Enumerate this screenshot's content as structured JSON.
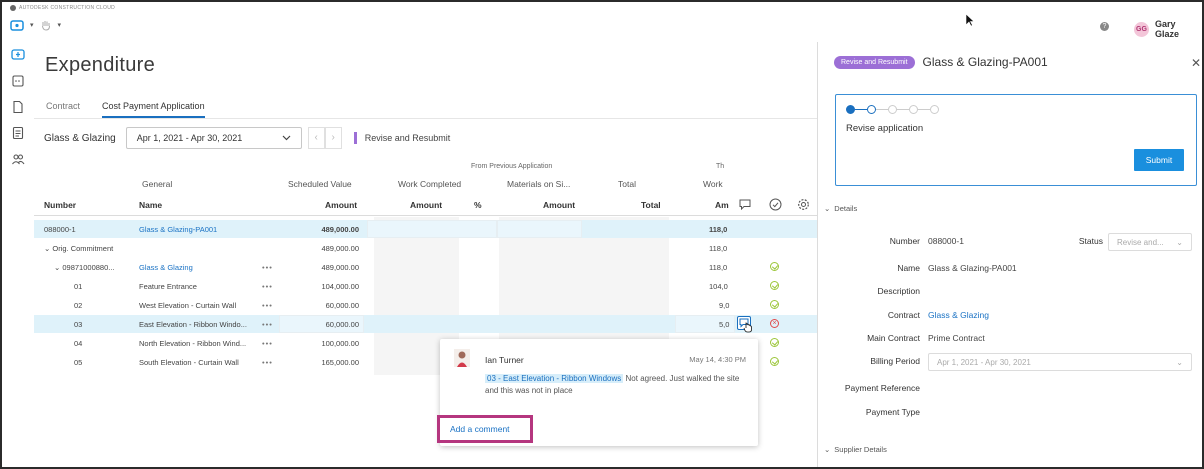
{
  "app": {
    "brand": "AUTODESK CONSTRUCTION CLOUD",
    "user_initials": "GG",
    "user_name": "Gary Glaze",
    "help_label": "?"
  },
  "page": {
    "title": "Expenditure",
    "tabs": [
      {
        "label": "Contract",
        "active": false
      },
      {
        "label": "Cost Payment Application",
        "active": true
      }
    ],
    "contract_name": "Glass & Glazing",
    "date_range": "Apr 1, 2021 - Apr 30, 2021",
    "status": "Revise and Resubmit",
    "status_color": "#9c6fd6"
  },
  "table": {
    "small_headers": [
      "From Previous Application",
      "Th"
    ],
    "group_headers": [
      "General",
      "Scheduled Value",
      "Work Completed",
      "Materials on Si...",
      "Total",
      "Work"
    ],
    "column_headers": [
      "Number",
      "Name",
      "Amount",
      "Amount",
      "%",
      "Amount",
      "Total",
      "Am"
    ],
    "rows": [
      {
        "number": "088000-1",
        "name": "Glass & Glazing-PA001",
        "name_link": true,
        "scheduled": "489,000.00",
        "this_work": "118,0",
        "selected": true,
        "bold": true,
        "menu": "",
        "status": ""
      },
      {
        "number": "⌄ Orig. Commitment",
        "name": "",
        "name_link": false,
        "scheduled": "489,000.00",
        "this_work": "118,0",
        "selected": false,
        "bold": false,
        "menu": "",
        "status": ""
      },
      {
        "number": "⌄ 09871000880...",
        "name": "Glass & Glazing",
        "name_link": true,
        "scheduled": "489,000.00",
        "this_work": "118,0",
        "selected": false,
        "bold": false,
        "menu": "•••",
        "status": "pending"
      },
      {
        "number": "01",
        "name": "Feature Entrance",
        "name_link": false,
        "scheduled": "104,000.00",
        "this_work": "104,0",
        "selected": false,
        "bold": false,
        "menu": "•••",
        "status": "ok"
      },
      {
        "number": "02",
        "name": "West Elevation - Curtain Wall",
        "name_link": false,
        "scheduled": "60,000.00",
        "this_work": "9,0",
        "selected": false,
        "bold": false,
        "menu": "•••",
        "status": "ok"
      },
      {
        "number": "03",
        "name": "East Elevation - Ribbon Windo...",
        "name_link": false,
        "scheduled": "60,000.00",
        "this_work": "5,0",
        "selected": true,
        "bold": false,
        "menu": "•••",
        "status": "rejected"
      },
      {
        "number": "04",
        "name": "North Elevation - Ribbon Wind...",
        "name_link": false,
        "scheduled": "100,000.00",
        "this_work": "",
        "selected": false,
        "bold": false,
        "menu": "•••",
        "status": "ok"
      },
      {
        "number": "05",
        "name": "South Elevation - Curtain Wall",
        "name_link": false,
        "scheduled": "165,000.00",
        "this_work": "",
        "selected": false,
        "bold": false,
        "menu": "•••",
        "status": "ok"
      }
    ]
  },
  "comment": {
    "author": "Ian Turner",
    "time": "May 14, 4:30 PM",
    "tag": "03 - East Elevation - Ribbon Windows",
    "text": "Not agreed. Just walked the site and this was not in place",
    "add_label": "Add a comment"
  },
  "panel": {
    "badge": "Revise and Resubmit",
    "title": "Glass & Glazing-PA001",
    "wizard_step": "Revise application",
    "submit_label": "Submit",
    "details_section": "Details",
    "supplier_section": "Supplier Details",
    "fields": {
      "number_label": "Number",
      "number_value": "088000-1",
      "status_label": "Status",
      "status_value": "Revise and...",
      "name_label": "Name",
      "name_value": "Glass & Glazing-PA001",
      "description_label": "Description",
      "contract_label": "Contract",
      "contract_value": "Glass & Glazing",
      "main_contract_label": "Main Contract",
      "main_contract_value": "Prime Contract",
      "billing_label": "Billing Period",
      "billing_value": "Apr 1, 2021 - Apr 30, 2021",
      "payment_ref_label": "Payment Reference",
      "payment_type_label": "Payment Type"
    }
  }
}
